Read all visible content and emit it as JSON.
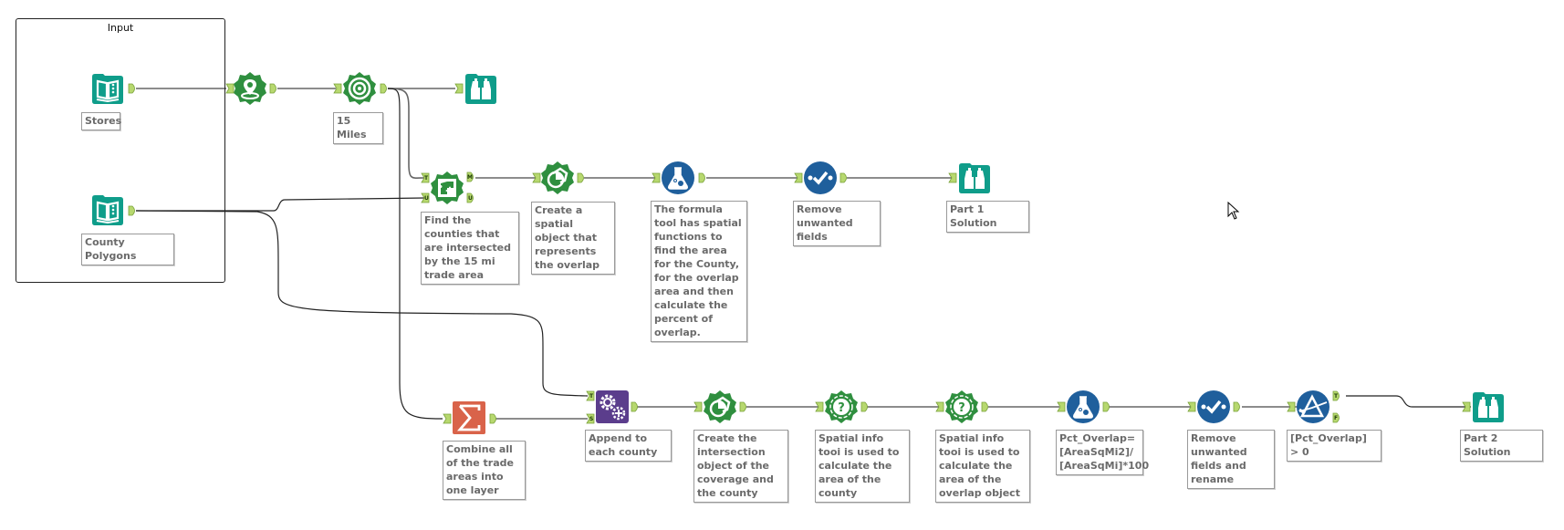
{
  "colors": {
    "input_teal": "#0f9d8a",
    "browse_teal": "#0f9d8a",
    "spatial_green": "#2f8f3f",
    "formula_blue": "#1f5f9c",
    "summarize_orange": "#d9634a",
    "append_purple": "#5b3d8c",
    "anchor_green": "#b7d86f",
    "connector_gray": "#666666"
  },
  "container": {
    "title": "Input"
  },
  "tools": [
    {
      "id": "input-stores",
      "type": "input-data",
      "icon": "book-icon",
      "note": "Stores"
    },
    {
      "id": "input-counties",
      "type": "input-data",
      "icon": "book-icon",
      "note": "County Polygons"
    },
    {
      "id": "create-points",
      "type": "create-points",
      "icon": "map-pin-icon",
      "note": ""
    },
    {
      "id": "trade-area",
      "type": "trade-area",
      "icon": "target-icon",
      "note": "15 Miles"
    },
    {
      "id": "browse-1",
      "type": "browse",
      "icon": "binoculars-icon",
      "note": ""
    },
    {
      "id": "spatial-match",
      "type": "spatial-match",
      "icon": "puzzle-icon",
      "note": "Find the counties that are intersected by the 15 mi trade area",
      "anchors_in": [
        "T",
        "U"
      ],
      "anchors_out": [
        "M",
        "U"
      ]
    },
    {
      "id": "spatial-process-1",
      "type": "spatial-process",
      "icon": "overlap-icon",
      "note": "Create a spatial object that represents the overlap"
    },
    {
      "id": "formula-1",
      "type": "formula",
      "icon": "flask-icon",
      "note": "The formula tool has spatial functions to find the area for the County, for the overlap area and then calculate the percent of overlap."
    },
    {
      "id": "select-1",
      "type": "select",
      "icon": "check-icon",
      "note": "Remove unwanted fields"
    },
    {
      "id": "browse-part1",
      "type": "browse",
      "icon": "binoculars-icon",
      "note": "Part 1 Solution"
    },
    {
      "id": "summarize",
      "type": "summarize",
      "icon": "sigma-icon",
      "note": "Combine all of the trade areas into one layer"
    },
    {
      "id": "append-fields",
      "type": "append-fields",
      "icon": "gears-icon",
      "note": "Append to each county",
      "anchors_in": [
        "T",
        "S"
      ]
    },
    {
      "id": "spatial-process-2",
      "type": "spatial-process",
      "icon": "overlap-icon",
      "note": "Create the intersection object of the coverage and the county"
    },
    {
      "id": "spatial-info-1",
      "type": "spatial-info",
      "icon": "question-icon",
      "note": "Spatial info tooi is used to calculate the area of the county"
    },
    {
      "id": "spatial-info-2",
      "type": "spatial-info",
      "icon": "question-icon",
      "note": "Spatial info tooi is used to calculate the area of the overlap object"
    },
    {
      "id": "formula-2",
      "type": "formula",
      "icon": "flask-icon",
      "note": "Pct_Overlap= [AreaSqMi2]/ [AreaSqMi]*100"
    },
    {
      "id": "select-2",
      "type": "select",
      "icon": "check-icon",
      "note": "Remove unwanted fields and rename"
    },
    {
      "id": "filter",
      "type": "filter",
      "icon": "filter-prism-icon",
      "note": "[Pct_Overlap] > 0",
      "anchors_out": [
        "T",
        "F"
      ]
    },
    {
      "id": "browse-part2",
      "type": "browse",
      "icon": "binoculars-icon",
      "note": "Part 2 Solution"
    }
  ],
  "connections": [
    {
      "from": "input-stores",
      "to": "create-points"
    },
    {
      "from": "create-points",
      "to": "trade-area"
    },
    {
      "from": "trade-area",
      "to": "browse-1"
    },
    {
      "from": "trade-area",
      "to": "spatial-match",
      "anchor": "T"
    },
    {
      "from": "trade-area",
      "to": "summarize"
    },
    {
      "from": "input-counties",
      "to": "spatial-match",
      "anchor": "U"
    },
    {
      "from": "input-counties",
      "to": "append-fields",
      "anchor": "T"
    },
    {
      "from": "spatial-match",
      "anchor_out": "M",
      "to": "spatial-process-1"
    },
    {
      "from": "spatial-process-1",
      "to": "formula-1"
    },
    {
      "from": "formula-1",
      "to": "select-1"
    },
    {
      "from": "select-1",
      "to": "browse-part1"
    },
    {
      "from": "summarize",
      "to": "append-fields",
      "anchor": "S"
    },
    {
      "from": "append-fields",
      "to": "spatial-process-2"
    },
    {
      "from": "spatial-process-2",
      "to": "spatial-info-1"
    },
    {
      "from": "spatial-info-1",
      "to": "spatial-info-2"
    },
    {
      "from": "spatial-info-2",
      "to": "formula-2"
    },
    {
      "from": "formula-2",
      "to": "select-2"
    },
    {
      "from": "select-2",
      "to": "filter"
    },
    {
      "from": "filter",
      "anchor_out": "T",
      "to": "browse-part2"
    }
  ]
}
